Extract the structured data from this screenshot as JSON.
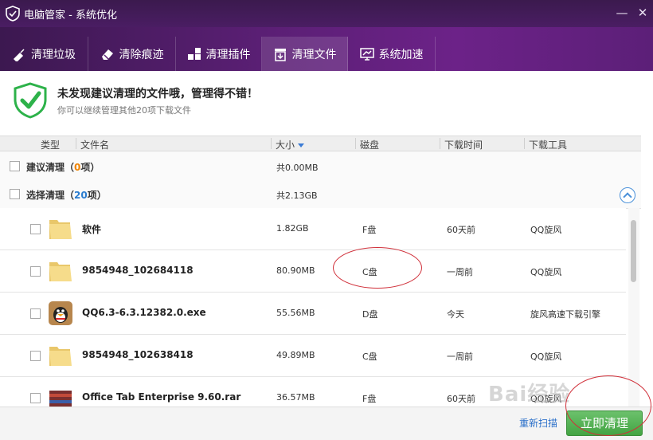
{
  "window": {
    "title": "电脑管家 - 系统优化",
    "min_glyph": "—",
    "close_glyph": "✕"
  },
  "tabs": [
    {
      "label": "清理垃圾",
      "icon": "broom-icon",
      "active": false
    },
    {
      "label": "清除痕迹",
      "icon": "eraser-icon",
      "active": false
    },
    {
      "label": "清理插件",
      "icon": "plugin-icon",
      "active": false
    },
    {
      "label": "清理文件",
      "icon": "file-clean-icon",
      "active": true
    },
    {
      "label": "系统加速",
      "icon": "monitor-speed-icon",
      "active": false
    }
  ],
  "banner": {
    "headline": "未发现建议清理的文件哦，管理得不错！",
    "sub": "你可以继续管理其他20项下载文件",
    "shield_color": "#2db24a"
  },
  "columns": {
    "type": "类型",
    "name": "文件名",
    "size": "大小",
    "disk": "磁盘",
    "time": "下载时间",
    "tool": "下载工具"
  },
  "groups": {
    "suggested": {
      "label": "建议清理",
      "open": "（",
      "count": "0",
      "unit": "项）",
      "size": "共0.00MB"
    },
    "selected": {
      "label": "选择清理",
      "open": "（",
      "count": "20",
      "unit": "项）",
      "size": "共2.13GB"
    }
  },
  "files": [
    {
      "name": "软件",
      "size": "1.82GB",
      "disk": "F盘",
      "time": "60天前",
      "tool": "QQ旋风",
      "icon": "folder-icon"
    },
    {
      "name": "9854948_102684118",
      "size": "80.90MB",
      "disk": "C盘",
      "time": "一周前",
      "tool": "QQ旋风",
      "icon": "folder-icon"
    },
    {
      "name": "QQ6.3-6.3.12382.0.exe",
      "size": "55.56MB",
      "disk": "D盘",
      "time": "今天",
      "tool": "旋风高速下载引擎",
      "icon": "qq-penguin-icon"
    },
    {
      "name": "9854948_102638418",
      "size": "49.89MB",
      "disk": "C盘",
      "time": "一周前",
      "tool": "QQ旋风",
      "icon": "folder-icon"
    },
    {
      "name": "Office Tab Enterprise 9.60.rar",
      "size": "36.57MB",
      "disk": "F盘",
      "time": "60天前",
      "tool": "QQ旋风",
      "icon": "archive-icon"
    }
  ],
  "footer": {
    "rescan": "重新扫描",
    "clean_now": "立即清理"
  },
  "watermark": "Bai经验",
  "colors": {
    "accent_purple": "#5a1f74",
    "clean_green": "#43a443",
    "annotation_red": "#d0303a"
  }
}
